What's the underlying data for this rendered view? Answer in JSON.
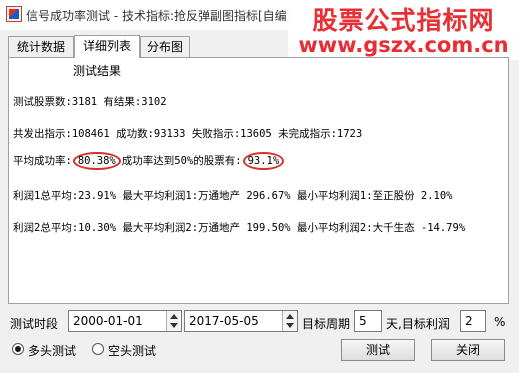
{
  "window": {
    "title": "信号成功率测试 - 技术指标:抢反弹副图指标[自编]"
  },
  "watermark": {
    "line1": "股票公式指标网",
    "line2": "www.gszx.com.cn"
  },
  "tabs": [
    "统计数据",
    "详细列表",
    "分布图"
  ],
  "results": {
    "heading": "测试结果",
    "stocks_line": "测试股票数:3181  有结果:3102",
    "signals_line": "共发出指示:108461  成功数:93133  失败指示:13605  未完成指示:1723",
    "avg_prefix": "平均成功率:",
    "avg_rate": "80.38%",
    "avg_mid": "成功率达到50%的股票有:",
    "avg_stock_pct": "93.1%",
    "profit1_line": "利润1总平均:23.91%  最大平均利润1:万通地产  296.67%  最小平均利润1:至正股份  2.10%",
    "profit2_line": "利润2总平均:10.30%  最大平均利润2:万通地产  199.50%  最小平均利润2:大千生态  -14.79%"
  },
  "params": {
    "period_label": "测试时段",
    "start_date": "2000-01-01",
    "end_date": "2017-05-05",
    "target_period_label": "目标周期",
    "target_period_value": "5",
    "target_profit_label": "天,目标利润",
    "target_profit_value": "2",
    "percent_label": "%"
  },
  "mode": {
    "long_label": "多头测试",
    "short_label": "空头测试",
    "selected": "long"
  },
  "buttons": {
    "test": "测试",
    "close": "关闭"
  }
}
